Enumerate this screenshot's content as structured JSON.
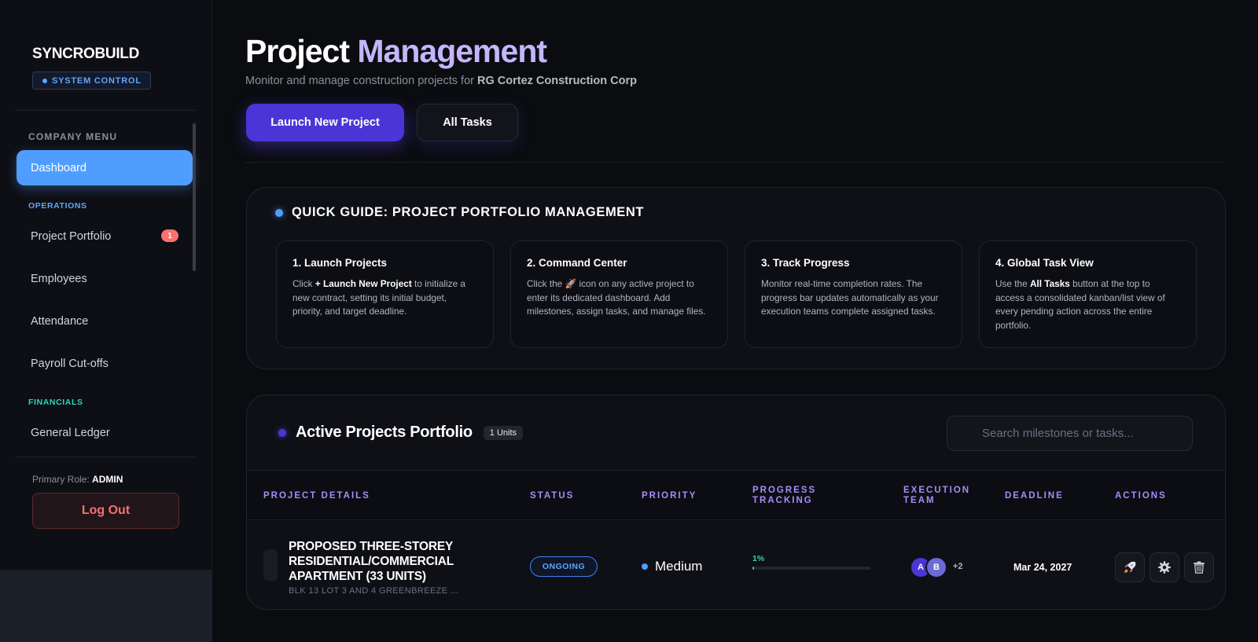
{
  "sidebar": {
    "brand": "SYNCROBUILD",
    "badge": "SYSTEM CONTROL",
    "company_menu": "COMPANY MENU",
    "dashboard": "Dashboard",
    "operations": "OPERATIONS",
    "project_portfolio": "Project Portfolio",
    "portfolio_count": "1",
    "employees": "Employees",
    "attendance": "Attendance",
    "payroll": "Payroll Cut-offs",
    "financials": "FINANCIALS",
    "general_ledger": "General Ledger",
    "role_label": "Primary Role:",
    "role_value": "ADMIN",
    "logout": "Log Out"
  },
  "header": {
    "title_part1": "Project",
    "title_part2": "Management",
    "subtitle": "Monitor and manage construction projects for",
    "company": "RG Cortez Construction Corp",
    "launch_button": "Launch New Project",
    "all_tasks_button": "All Tasks"
  },
  "guide": {
    "title": "QUICK GUIDE: PROJECT PORTFOLIO MANAGEMENT",
    "steps": [
      {
        "title": "1. Launch Projects",
        "pre": "Click",
        "bold": "+ Launch New Project",
        "post": "to initialize a new contract, setting its initial budget, priority, and target deadline."
      },
      {
        "title": "2. Command Center",
        "pre": "Click the",
        "icon": "🚀",
        "post": "icon on any active project to enter its dedicated dashboard. Add milestones, assign tasks, and manage files."
      },
      {
        "title": "3. Track Progress",
        "text": "Monitor real-time completion rates. The progress bar updates automatically as your execution teams complete assigned tasks."
      },
      {
        "title": "4. Global Task View",
        "pre": "Use the",
        "bold": "All Tasks",
        "post": "button at the top to access a consolidated kanban/list view of every pending action across the entire portfolio."
      }
    ]
  },
  "portfolio": {
    "title": "Active Projects Portfolio",
    "units": "1 Units",
    "search_placeholder": "Search milestones or tasks...",
    "columns": [
      "PROJECT DETAILS",
      "STATUS",
      "PRIORITY",
      "PROGRESS TRACKING",
      "EXECUTION TEAM",
      "DEADLINE",
      "ACTIONS"
    ],
    "rows": [
      {
        "name": "PROPOSED THREE-STOREY RESIDENTIAL/COMMERCIAL APARTMENT (33 UNITS)",
        "location": "BLK 13 LOT 3 AND 4 GREENBREEZE ...",
        "status": "ONGOING",
        "priority": "Medium",
        "progress_label": "1%",
        "progress": 1,
        "team": [
          "A",
          "B"
        ],
        "team_more": "+2",
        "deadline": "Mar 24, 2027"
      }
    ]
  },
  "colors": {
    "accent": "#4f9eff",
    "primary_button": "#4c35d6",
    "header_violet": "#a78bfa",
    "progress": "#34d399",
    "danger": "#f87171"
  },
  "icons": {
    "command_center": "rocket-icon",
    "settings": "gear-icon",
    "delete": "trash-icon"
  }
}
